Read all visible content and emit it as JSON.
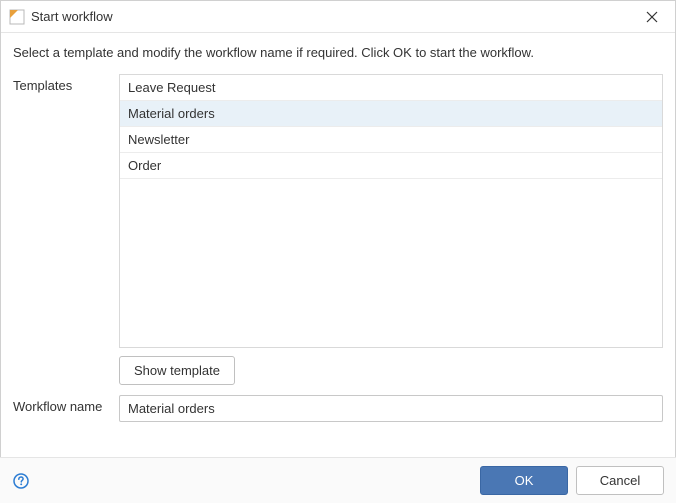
{
  "titlebar": {
    "title": "Start workflow"
  },
  "instruction": "Select a template and modify the workflow name if required. Click OK to start the workflow.",
  "labels": {
    "templates": "Templates",
    "workflow_name": "Workflow name"
  },
  "templates": {
    "items": [
      {
        "label": "Leave Request",
        "selected": false
      },
      {
        "label": "Material orders",
        "selected": true
      },
      {
        "label": "Newsletter",
        "selected": false
      },
      {
        "label": "Order",
        "selected": false
      }
    ]
  },
  "buttons": {
    "show_template": "Show template",
    "ok": "OK",
    "cancel": "Cancel"
  },
  "workflow_name": {
    "value": "Material orders"
  },
  "colors": {
    "primary": "#4a77b4",
    "selected_row": "#e8f1f8"
  }
}
